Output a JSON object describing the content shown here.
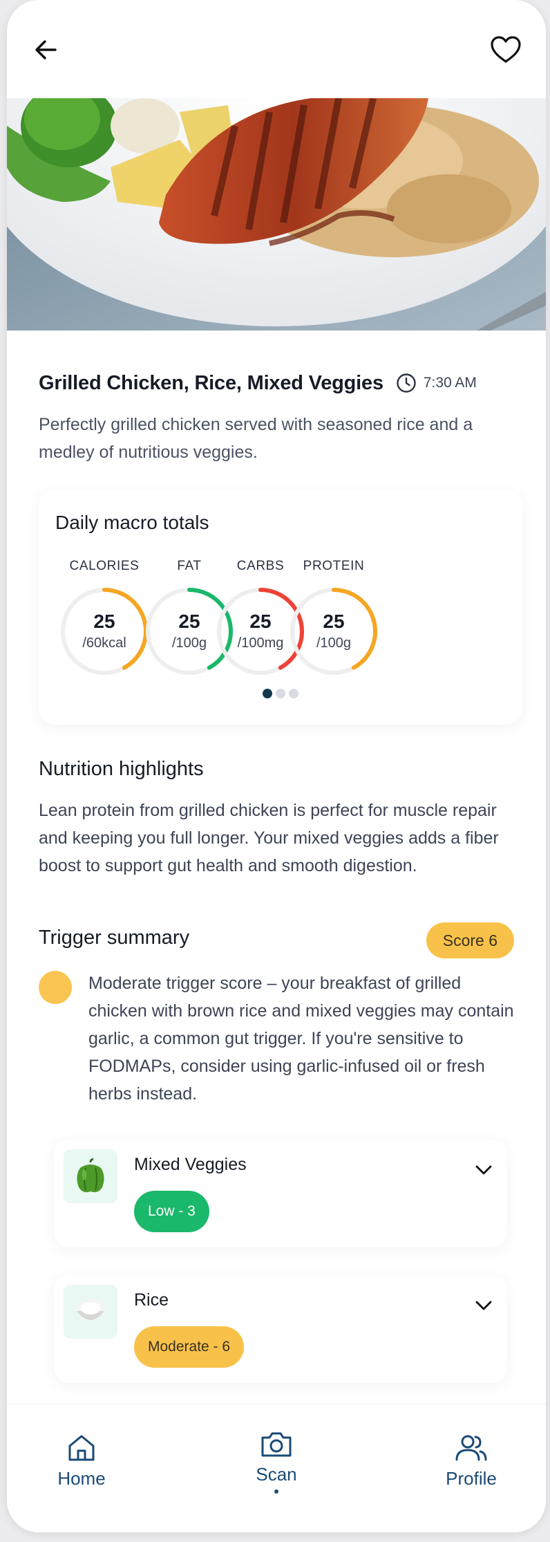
{
  "header": {
    "back_icon": "arrow-left-icon",
    "favorite_icon": "heart-icon"
  },
  "hero": {
    "image": "grilled-meal-photo"
  },
  "meal": {
    "title": "Grilled Chicken, Rice, Mixed Veggies",
    "time": "7:30 AM",
    "description": "Perfectly grilled chicken served with seasoned rice and a medley of nutritious veggies."
  },
  "macros": {
    "heading": "Daily macro totals",
    "items": [
      {
        "label": "CALORIES",
        "value": "25",
        "unit": "/60kcal",
        "fraction": 0.42,
        "color": "#f5a623"
      },
      {
        "label": "FAT",
        "value": "25",
        "unit": "/100g",
        "fraction": 0.42,
        "color": "#1ab86a"
      },
      {
        "label": "CARBS",
        "value": "25",
        "unit": "/100mg",
        "fraction": 0.42,
        "color": "#ee4336"
      },
      {
        "label": "PROTEIN",
        "value": "25",
        "unit": "/100g",
        "fraction": 0.42,
        "color": "#f5a623"
      }
    ],
    "track_color": "#eeeeee",
    "carousel_pages": 3,
    "carousel_active": 1
  },
  "highlights": {
    "title": "Nutrition highlights",
    "text": "Lean protein from grilled chicken is perfect for muscle repair and keeping you full longer. Your mixed veggies adds a fiber boost to support gut health and smooth digestion."
  },
  "trigger": {
    "title": "Trigger summary",
    "score_label": "Score 6",
    "indicator_color": "#f9c451",
    "text": "Moderate trigger score – your breakfast of grilled chicken with brown rice and mixed veggies may contain garlic, a common gut trigger. If you're sensitive to FODMAPs, consider using garlic-infused oil or fresh herbs instead."
  },
  "ingredients": [
    {
      "name": "Mixed Veggies",
      "badge": "Low  - 3",
      "level": "low",
      "icon": "green-pepper-icon"
    },
    {
      "name": "Rice",
      "badge": "Moderate - 6",
      "level": "moderate",
      "icon": "rice-bowl-icon"
    }
  ],
  "nav": {
    "items": [
      {
        "label": "Home",
        "icon": "home-icon"
      },
      {
        "label": "Scan",
        "icon": "camera-icon",
        "active": true
      },
      {
        "label": "Profile",
        "icon": "users-icon"
      }
    ],
    "color": "#1b4a76"
  }
}
